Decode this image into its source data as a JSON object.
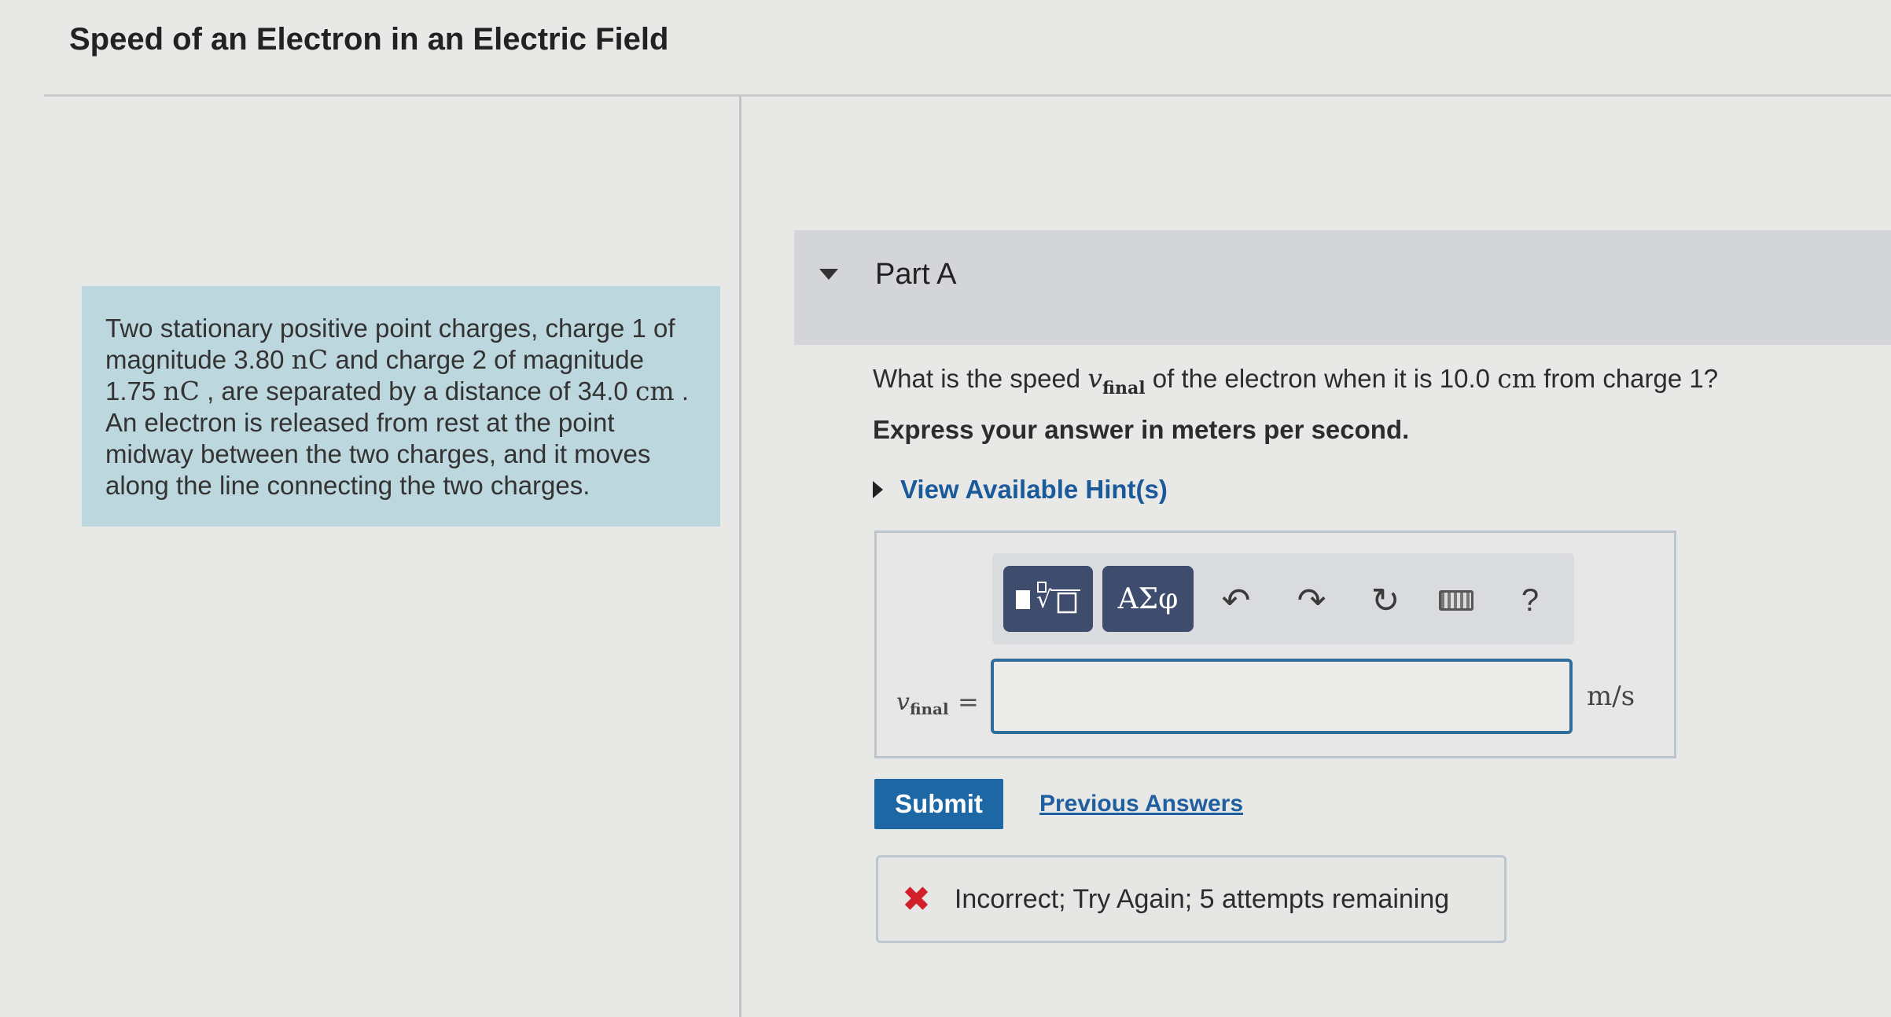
{
  "page": {
    "title": "Speed of an Electron in an Electric Field"
  },
  "problem": {
    "t1": "Two stationary positive point charges, charge 1 of magnitude 3.80 ",
    "u1": "nC",
    "t2": " and charge 2 of magnitude 1.75 ",
    "u2": "nC",
    "t3": " , are separated by a distance of 34.0 ",
    "u3": "cm",
    "t4": " . An electron is released from rest at the point midway between the two charges, and it moves along the line connecting the two charges."
  },
  "part": {
    "title": "Part A"
  },
  "question": {
    "pre": "What is the speed ",
    "var": "v",
    "var_sub": "final",
    "mid": " of the electron when it is 10.0 ",
    "unit": "cm",
    "post": " from charge 1?"
  },
  "instruction": "Express your answer in meters per second.",
  "hints": {
    "label": "View Available Hint(s)"
  },
  "toolbar": {
    "templates_icon": "templates-icon",
    "symbols_label": "ΑΣφ",
    "undo_glyph": "↶",
    "redo_glyph": "↷",
    "reset_glyph": "↻",
    "help_label": "?"
  },
  "answer": {
    "var": "v",
    "var_sub": "final",
    "equals": "=",
    "value": "",
    "unit": "m/s"
  },
  "actions": {
    "submit_label": "Submit",
    "previous_answers_label": "Previous Answers"
  },
  "feedback": {
    "icon": "✖",
    "message": "Incorrect; Try Again; 5 attempts remaining"
  },
  "colors": {
    "accent": "#1e67a5",
    "problem_bg": "#bcd7dd",
    "toolbar_btn": "#3e4c6e",
    "error": "#d1202a"
  }
}
